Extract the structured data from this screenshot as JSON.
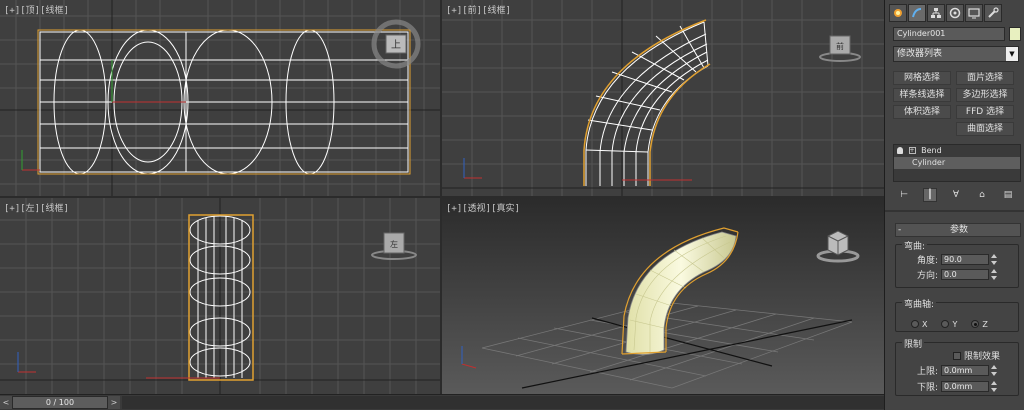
{
  "viewports": {
    "top": {
      "label": "[+][顶][线框]",
      "view_cube_text": "上"
    },
    "front": {
      "label": "[+][前][线框]",
      "view_cube_text": "前"
    },
    "left": {
      "label": "[+][左][线框]",
      "view_cube_text": "左"
    },
    "perspective": {
      "label": "[+][透视][真实]",
      "view_cube_text": ""
    }
  },
  "timeline": {
    "prev": "<",
    "next": ">",
    "position": "0 / 100",
    "current_frame": 0,
    "total_frames": 100
  },
  "command_panel": {
    "tabs": [
      {
        "icon": "create-icon",
        "active": false
      },
      {
        "icon": "modify-icon",
        "active": true
      },
      {
        "icon": "hierarchy-icon",
        "active": false
      },
      {
        "icon": "motion-icon",
        "active": false
      },
      {
        "icon": "display-icon",
        "active": false
      },
      {
        "icon": "utilities-icon",
        "active": false
      }
    ],
    "object_name": "Cylinder001",
    "object_color": "#e8f0c0",
    "modifier_list": "修改器列表",
    "selection_buttons": [
      "网格选择",
      "面片选择",
      "样条线选择",
      "多边形选择",
      "体积选择",
      "FFD 选择",
      "曲面选择"
    ],
    "stack": [
      {
        "label": "Bend",
        "selected": false
      },
      {
        "label": "Cylinder",
        "selected": true
      }
    ],
    "params": {
      "rollout_title": "参数",
      "bend_group": "弯曲:",
      "angle_label": "角度:",
      "angle_value": "90.0",
      "direction_label": "方向:",
      "direction_value": "0.0",
      "axis_group": "弯曲轴:",
      "axes": [
        {
          "label": "X",
          "checked": false
        },
        {
          "label": "Y",
          "checked": false
        },
        {
          "label": "Z",
          "checked": true
        }
      ],
      "limit_group": "限制",
      "limit_effect_label": "限制效果",
      "upper_label": "上限:",
      "upper_value": "0.0mm",
      "lower_label": "下限:",
      "lower_value": "0.0mm"
    }
  },
  "colors": {
    "viewport_bg": "#3f3f3f",
    "grid": "#545454",
    "wire": "#ffffff",
    "selection": "#e0a030",
    "active_border": "#c8a14a",
    "bend_fill": "#f0f0c8"
  }
}
